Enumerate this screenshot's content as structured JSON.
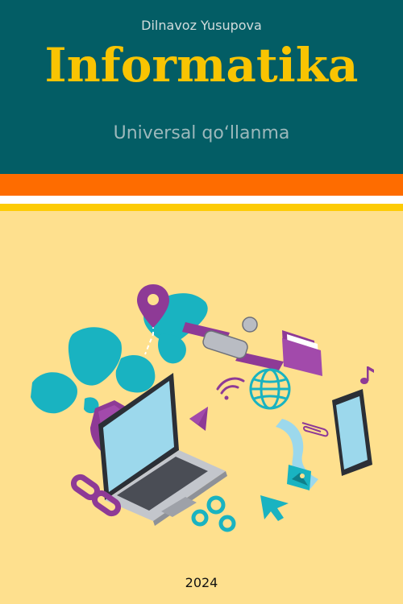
{
  "cover": {
    "author": "Dilnavoz Yusupova",
    "title": "Informatika",
    "subtitle": "Universal qo‘llanma",
    "year": "2024"
  },
  "colors": {
    "header_bg": "#035d65",
    "title": "#f9c402",
    "orange_stripe": "#fe6c00",
    "yellow_stripe": "#fdcb05",
    "page_bg": "#fee08e",
    "illustration_cyan": "#19b3c1",
    "illustration_purple": "#8e3a96"
  },
  "illustration": {
    "icons": [
      "world-map-icon",
      "location-pin-icon",
      "satellite-icon",
      "folder-icon",
      "music-note-icon",
      "wifi-icon",
      "globe-icon",
      "shield-icon",
      "laptop-icon",
      "tablet-icon",
      "paperclip-icon",
      "chain-link-icon",
      "gears-icon",
      "cursor-arrow-icon",
      "image-card-icon",
      "paper-plane-icon"
    ]
  }
}
